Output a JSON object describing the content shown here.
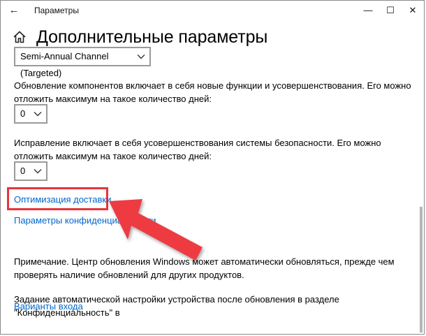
{
  "window": {
    "title": "Параметры",
    "back_icon": "arrow-left-icon",
    "minimize_icon": "minimize-icon",
    "maximize_icon": "maximize-icon",
    "close_icon": "close-icon"
  },
  "header": {
    "home_icon": "home-icon",
    "title": "Дополнительные параметры"
  },
  "channel_select": {
    "value": "Semi-Annual Channel (Targeted)"
  },
  "feature_update": {
    "description": "Обновление компонентов включает в себя новые функции и усовершенствования. Его можно отложить максимум на такое количество дней:",
    "value": "0"
  },
  "quality_update": {
    "description": "Исправление включает в себя усовершенствования системы безопасности. Его можно отложить максимум на такое количество дней:",
    "value": "0"
  },
  "links": {
    "delivery_optimization": "Оптимизация доставки",
    "privacy_settings": "Параметры конфиденциальности"
  },
  "note": "Примечание. Центр обновления Windows может автоматически обновляться, прежде чем проверять наличие обновлений для других продуктов.",
  "auto_setup": {
    "text": "Задание автоматической настройки устройства после обновления в разделе \"Конфиденциальность\" в",
    "link": "Варианты входа"
  },
  "colors": {
    "link": "#0066cc",
    "highlight": "#e8333c",
    "arrow": "#ee3a43"
  }
}
